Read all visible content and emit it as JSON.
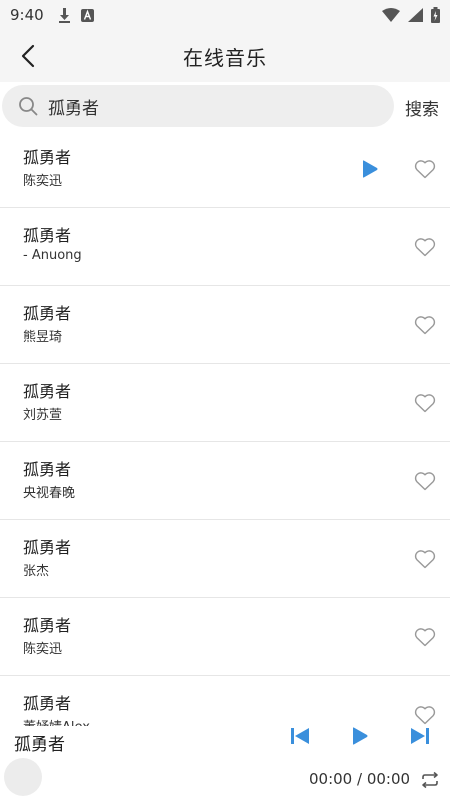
{
  "status_bar": {
    "time": "9:40",
    "icons": [
      "download-icon",
      "app-a-icon",
      "wifi-icon",
      "signal-icon",
      "battery-icon"
    ]
  },
  "header": {
    "title": "在线音乐"
  },
  "search": {
    "value": "孤勇者",
    "button_label": "搜索"
  },
  "songs": [
    {
      "title": "孤勇者",
      "artist": "陈奕迅",
      "playing": true
    },
    {
      "title": "孤勇者",
      "artist": "- Anuong"
    },
    {
      "title": "孤勇者",
      "artist": "熊昱琦"
    },
    {
      "title": "孤勇者",
      "artist": "刘苏萱"
    },
    {
      "title": "孤勇者",
      "artist": "央视春晚"
    },
    {
      "title": "孤勇者",
      "artist": "张杰"
    },
    {
      "title": "孤勇者",
      "artist": "陈奕迅"
    },
    {
      "title": "孤勇者",
      "artist": "董妤婧Alex"
    }
  ],
  "player": {
    "title": "孤勇者",
    "time": "00:00 / 00:00"
  },
  "colors": {
    "accent": "#3a8fdc",
    "header_bg": "#f5f5f5",
    "search_bg": "#eeeeee"
  }
}
